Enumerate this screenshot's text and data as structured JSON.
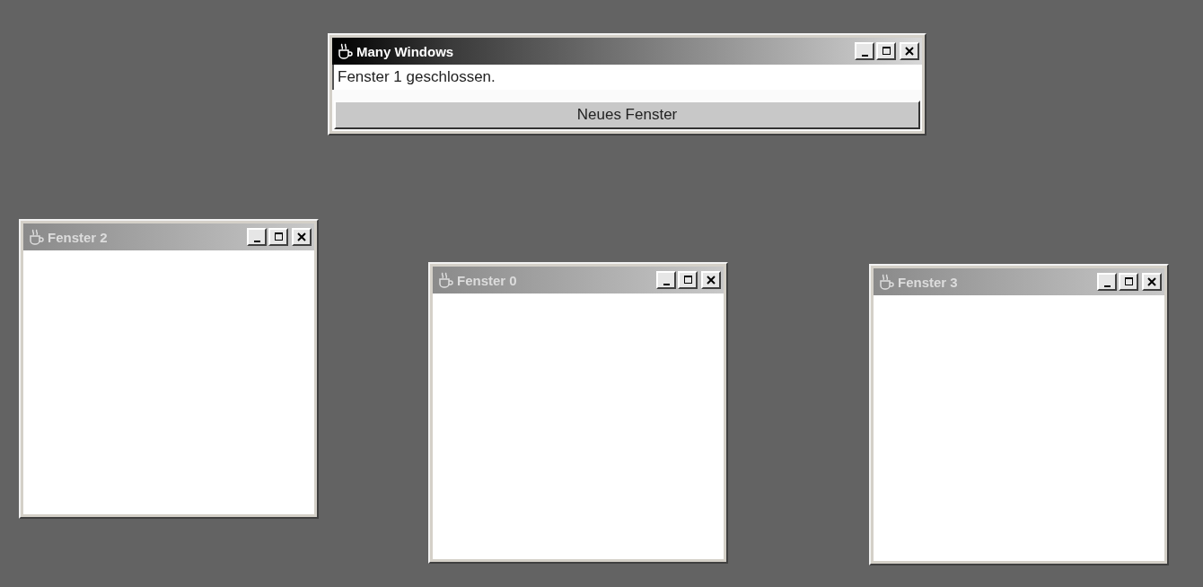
{
  "windows": [
    {
      "kind": "main",
      "title": "Many Windows",
      "active": true,
      "status": "Fenster 1 geschlossen.",
      "button": "Neues Fenster"
    },
    {
      "kind": "empty",
      "title": "Fenster 2",
      "active": false
    },
    {
      "kind": "empty",
      "title": "Fenster 0",
      "active": false
    },
    {
      "kind": "empty",
      "title": "Fenster 3",
      "active": false
    }
  ]
}
